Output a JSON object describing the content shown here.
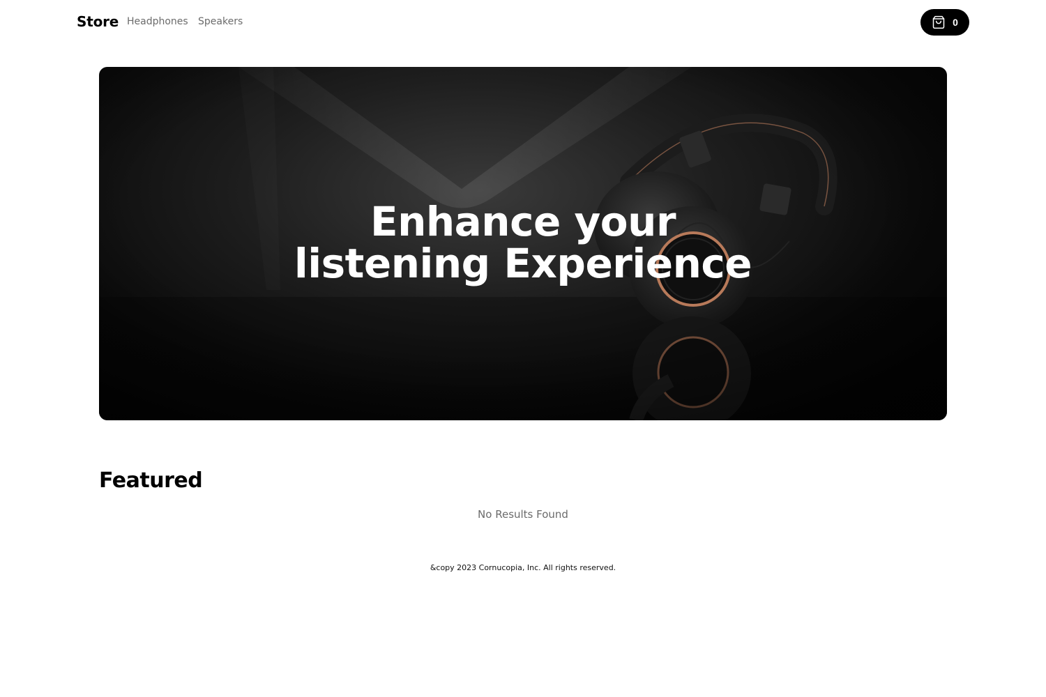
{
  "nav": {
    "brand": "Store",
    "links": [
      "Headphones",
      "Speakers"
    ],
    "cart": {
      "icon": "shopping-bag-icon",
      "count": "0"
    }
  },
  "hero": {
    "title_line1": "Enhance your",
    "title_line2": "listening Experience",
    "image": "headphones-photo"
  },
  "featured": {
    "title": "Featured",
    "empty_text": "No Results Found"
  },
  "footer": {
    "text": "&copy 2023 Cornucopia, Inc. All rights reserved."
  },
  "colors": {
    "background": "#ffffff",
    "text": "#000000",
    "muted": "#6b6b6b",
    "cart_bg": "#000000",
    "hero_dark": "#0b0b0b",
    "copper_accent": "#b87a5a"
  }
}
